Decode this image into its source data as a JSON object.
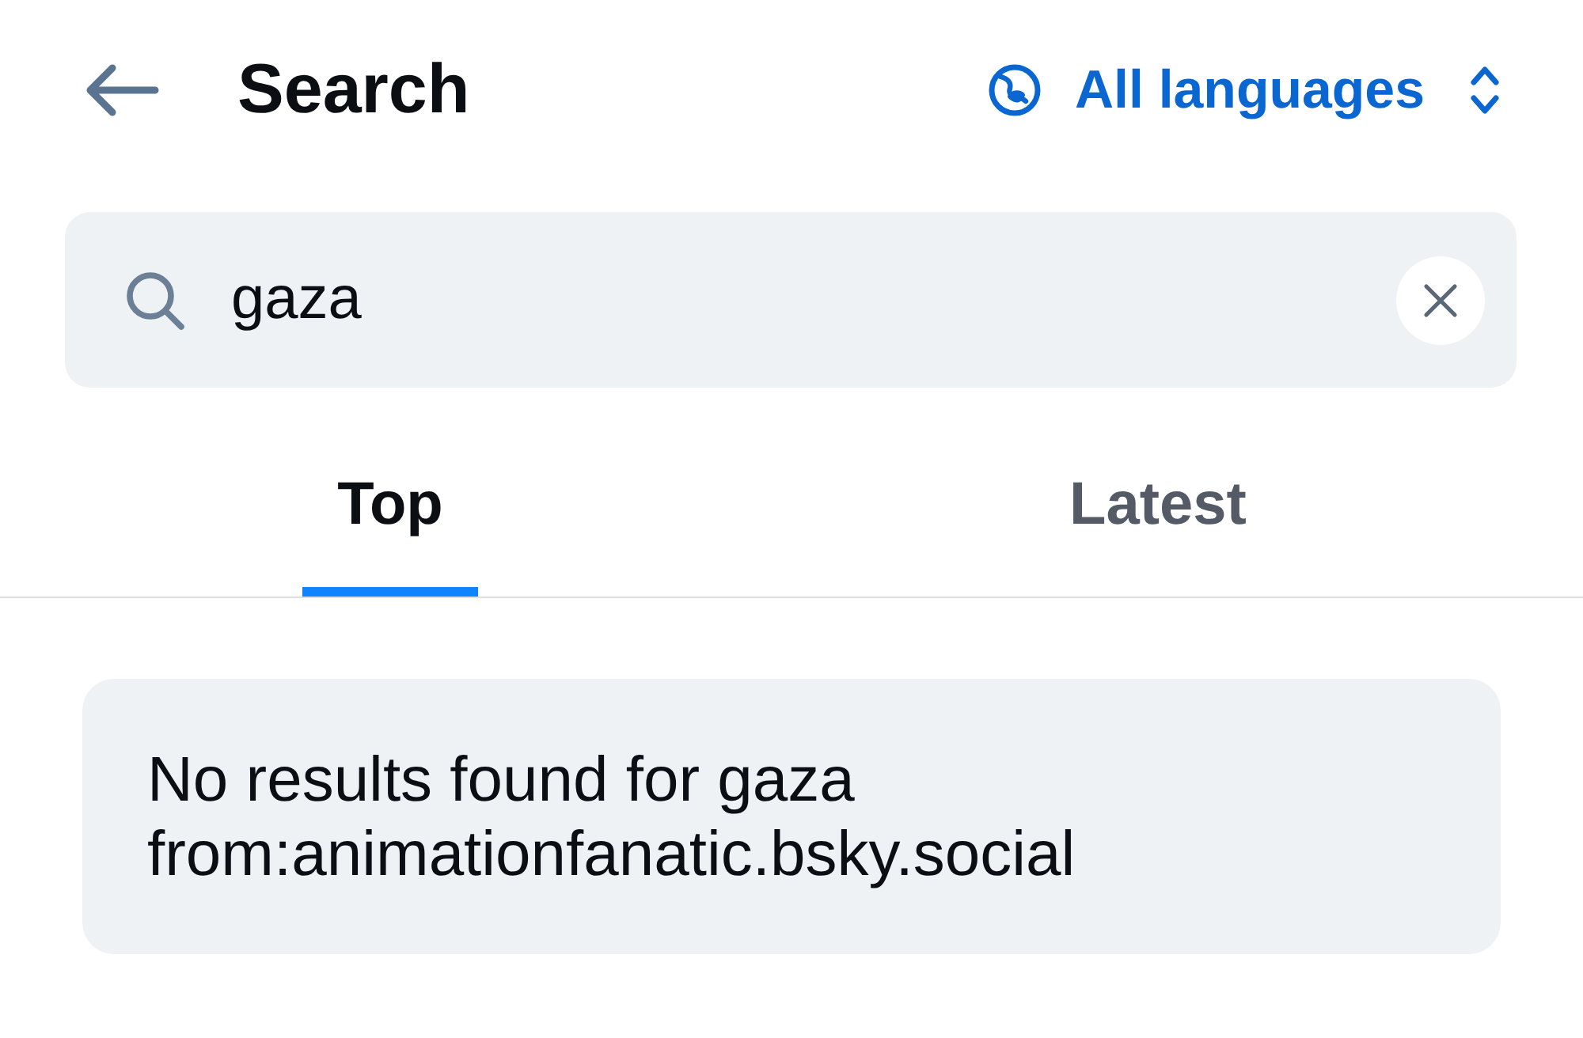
{
  "header": {
    "title": "Search",
    "language_picker": {
      "label": "All languages"
    }
  },
  "search": {
    "value": "gaza"
  },
  "tabs": [
    {
      "label": "Top",
      "selected": true
    },
    {
      "label": "Latest",
      "selected": false
    }
  ],
  "message": "No results found for gaza from:animationfanatic.bsky.social"
}
